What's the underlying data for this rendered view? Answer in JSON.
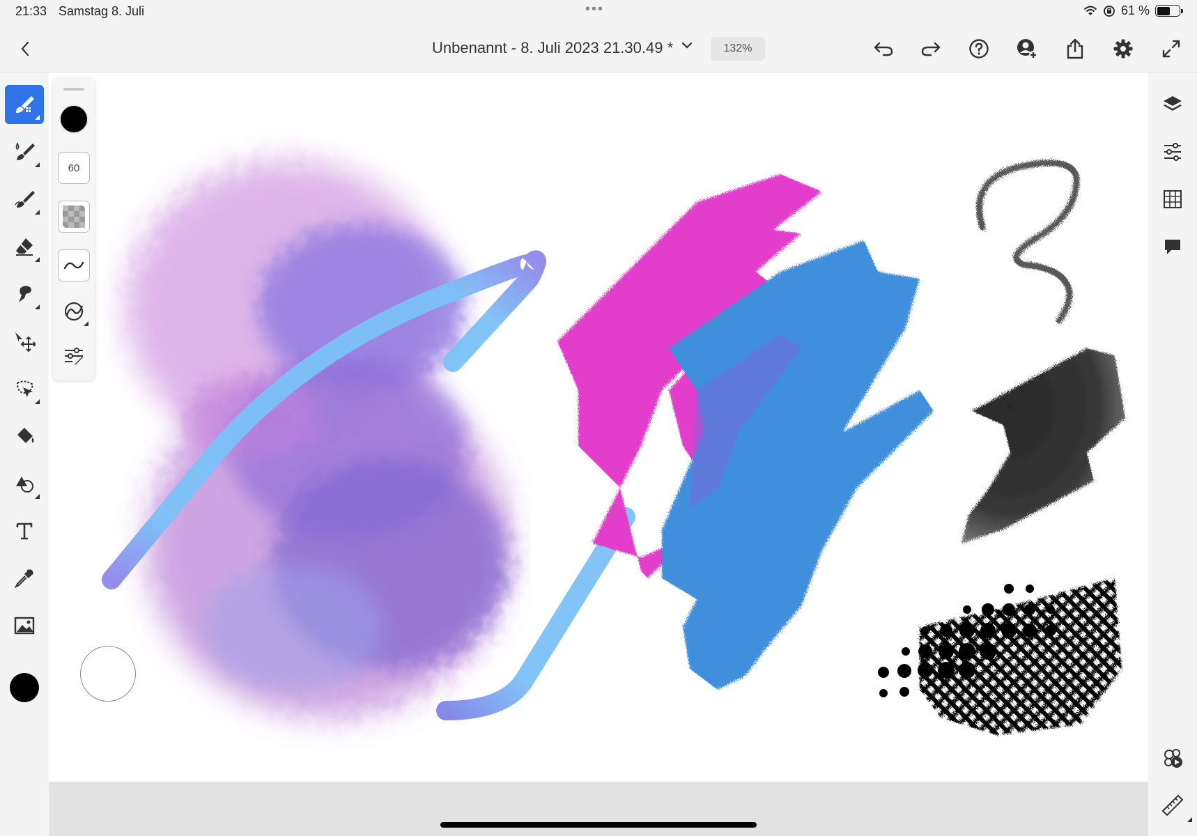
{
  "status_bar": {
    "time": "21:33",
    "date": "Samstag 8. Juli",
    "battery": "61 %",
    "battery_level": 0.61
  },
  "top_bar": {
    "title": "Unbenannt - 8. Juli 2023 21.30.49 *",
    "zoom": "132%",
    "icons": [
      "back-icon",
      "chevron-down-icon",
      "undo-icon",
      "redo-icon",
      "help-icon",
      "invite-user-icon",
      "share-icon",
      "gear-icon",
      "fullscreen-icon"
    ]
  },
  "left_toolbar": {
    "tools": [
      "pixel-brush-tool",
      "live-brush-tool",
      "vector-brush-tool",
      "eraser-tool",
      "smudge-tool",
      "transform-tool",
      "lasso-tool",
      "fill-tool",
      "shapes-tool",
      "text-tool",
      "eyedropper-tool",
      "image-tool"
    ],
    "active_tool": "pixel-brush-tool",
    "current_color": "#000000"
  },
  "brush_panel": {
    "color": "#000000",
    "size": "60",
    "buttons": [
      "opacity-icon",
      "smoothing-icon",
      "pressure-icon",
      "brush-settings-icon"
    ]
  },
  "right_toolbar": {
    "icons": [
      "layers-icon",
      "adjustments-icon",
      "grid-icon",
      "comment-icon",
      "timelapse-icon",
      "ruler-icon"
    ]
  },
  "colors": {
    "accent": "#2e74e8",
    "magenta": "#e23ecb",
    "blue": "#3f8fdc",
    "light_blue": "#7bc1f7",
    "violet": "#8a6fe0",
    "lilac": "#c98ae0"
  }
}
